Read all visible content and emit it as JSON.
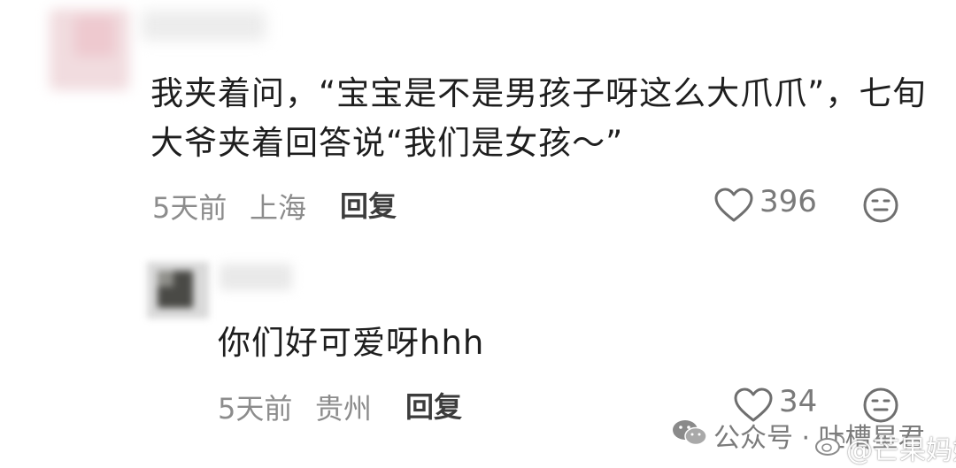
{
  "comments": [
    {
      "text": "我夹着问，“宝宝是不是男孩子呀这么大爪爪”，七旬大爷夹着回答说“我们是女孩～”",
      "time": "5天前",
      "location": "上海",
      "reply_label": "回复",
      "likes": "396"
    },
    {
      "text": "你们好可爱呀hhh",
      "time": "5天前",
      "location": "贵州",
      "reply_label": "回复",
      "likes": "34"
    }
  ],
  "watermarks": {
    "wechat_account": "公众号 · 吐槽星君",
    "weibo_account": "@芒果妈妈"
  },
  "icons": {
    "like": "heart-icon",
    "dislike": "meh-face-icon",
    "wechat": "wechat-logo-icon",
    "weibo": "weibo-logo-icon"
  }
}
